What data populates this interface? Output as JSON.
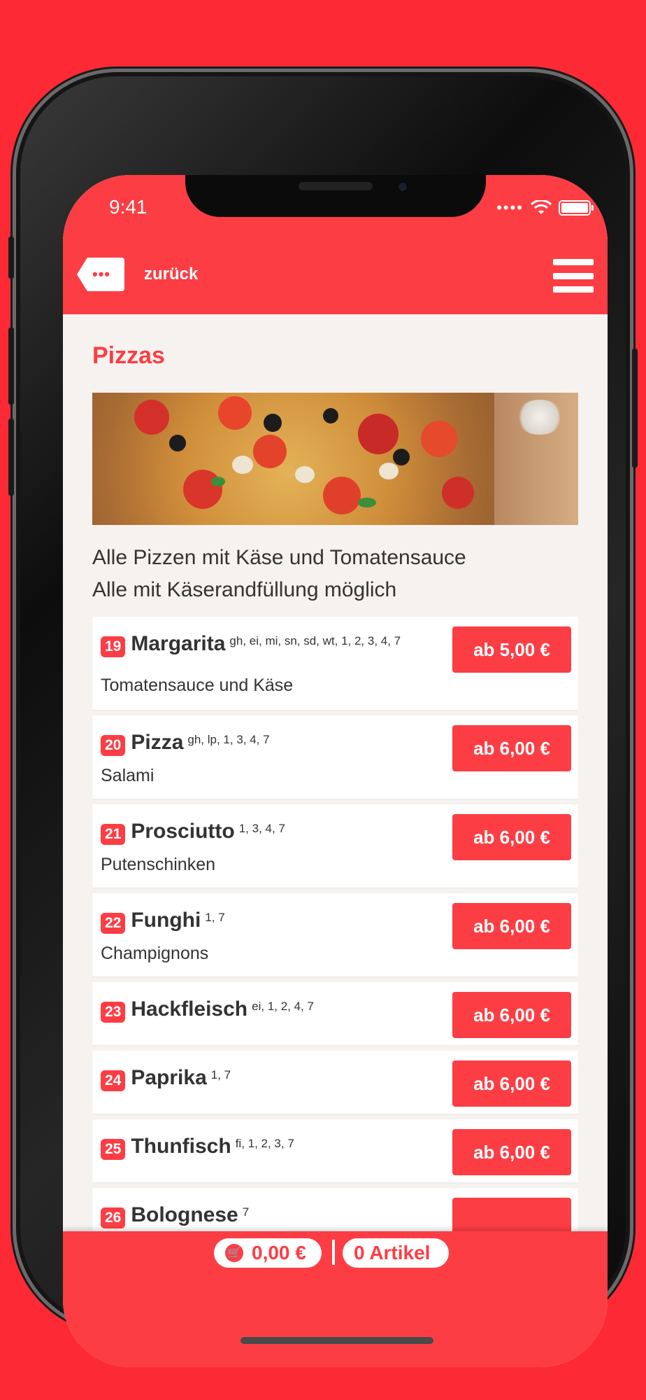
{
  "status_bar": {
    "time": "9:41"
  },
  "header": {
    "back_label": "zurück",
    "back_icon": "ellipsis-tag-icon",
    "menu_icon": "hamburger-menu-icon"
  },
  "category": {
    "title": "Pizzas",
    "image": "pizza-photo",
    "description_line1": "Alle Pizzen mit Käse und Tomatensauce",
    "description_line2": "Alle mit Käserandfüllung möglich"
  },
  "items": [
    {
      "number": "19",
      "name": "Margarita",
      "allergens": "gh, ei, mi, sn, sd, wt, 1, 2, 3, 4, 7",
      "description": "Tomatensauce und Käse",
      "price": "ab 5,00 €"
    },
    {
      "number": "20",
      "name": "Pizza",
      "allergens": "gh, lp, 1, 3, 4, 7",
      "description": "Salami",
      "price": "ab 6,00 €"
    },
    {
      "number": "21",
      "name": "Prosciutto",
      "allergens": "1, 3, 4, 7",
      "description": "Putenschinken",
      "price": "ab 6,00 €"
    },
    {
      "number": "22",
      "name": "Funghi",
      "allergens": "1, 7",
      "description": "Champignons",
      "price": "ab 6,00 €"
    },
    {
      "number": "23",
      "name": "Hackfleisch",
      "allergens": "ei, 1, 2, 4, 7",
      "description": "",
      "price": "ab 6,00 €"
    },
    {
      "number": "24",
      "name": "Paprika",
      "allergens": "1, 7",
      "description": "",
      "price": "ab 6,00 €"
    },
    {
      "number": "25",
      "name": "Thunfisch",
      "allergens": "fi, 1, 2, 3, 7",
      "description": "",
      "price": "ab 6,00 €"
    },
    {
      "number": "26",
      "name": "Bolognese",
      "allergens": "7",
      "description": "",
      "price": ""
    }
  ],
  "cart": {
    "total": "0,00 €",
    "articles": "0 Artikel",
    "icon": "shopping-cart-icon"
  },
  "colors": {
    "brand_red": "#fd3d44",
    "background_red": "#fd2a35"
  }
}
